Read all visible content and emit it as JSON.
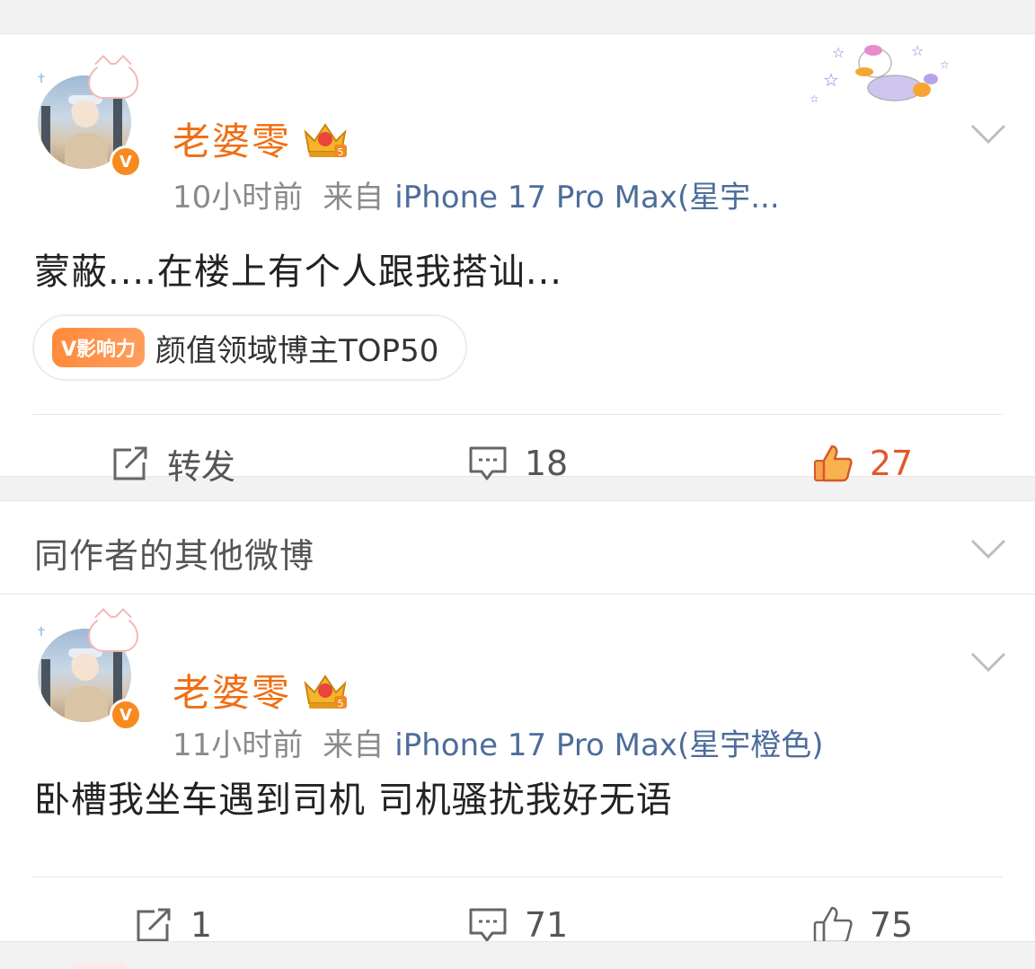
{
  "post1": {
    "username": "老婆零",
    "time": "10小时前",
    "source_label": "来自",
    "device": "iPhone 17 Pro Max(星宇...",
    "text": "蒙蔽....在楼上有个人跟我搭讪...",
    "influence_badge": "V影响力",
    "influence_text": "颜值领域博主TOP50",
    "repost_label": "转发",
    "comment_count": "18",
    "like_count": "27",
    "verified_mark": "V"
  },
  "section": {
    "title": "同作者的其他微博"
  },
  "post2": {
    "username": "老婆零",
    "time": "11小时前",
    "source_label": "来自",
    "device": "iPhone 17 Pro Max(星宇橙色)",
    "text": "卧槽我坐车遇到司机 司机骚扰我好无语",
    "repost_count": "1",
    "comment_count": "71",
    "like_count": "75",
    "verified_mark": "V"
  },
  "colors": {
    "username": "#f06e12",
    "device_link": "#4d6d9a",
    "like_active": "#e2572a",
    "verified": "#f78a1f"
  }
}
